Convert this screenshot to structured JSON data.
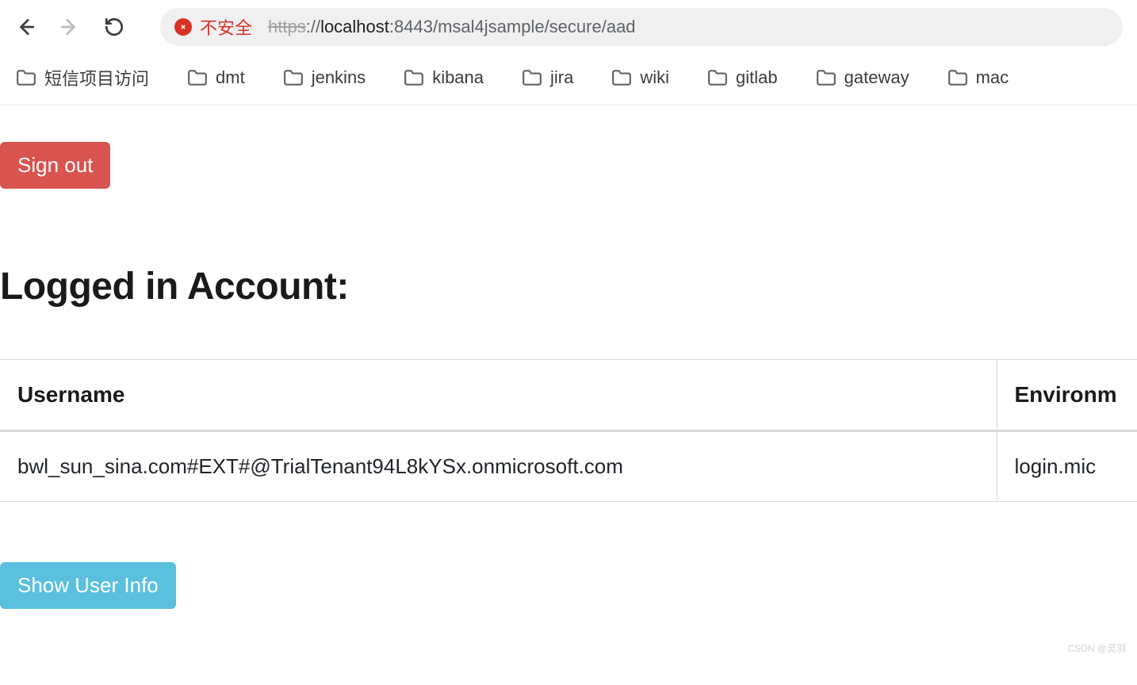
{
  "browser": {
    "insecure_label": "不安全",
    "url": {
      "protocol": "https",
      "sep": "://",
      "host": "localhost",
      "port": ":8443",
      "path": "/msal4jsample/secure/aad"
    }
  },
  "bookmarks": [
    {
      "label": "短信项目访问"
    },
    {
      "label": "dmt"
    },
    {
      "label": "jenkins"
    },
    {
      "label": "kibana"
    },
    {
      "label": "jira"
    },
    {
      "label": "wiki"
    },
    {
      "label": "gitlab"
    },
    {
      "label": "gateway"
    },
    {
      "label": "mac"
    }
  ],
  "page": {
    "sign_out_label": "Sign out",
    "heading": "Logged in Account:",
    "table": {
      "headers": {
        "username": "Username",
        "environment": "Environm"
      },
      "row": {
        "username": "bwl_sun_sina.com#EXT#@TrialTenant94L8kYSx.onmicrosoft.com",
        "environment": "login.mic"
      }
    },
    "show_user_info_label": "Show User Info"
  },
  "watermark": "CSDN @灵羽"
}
